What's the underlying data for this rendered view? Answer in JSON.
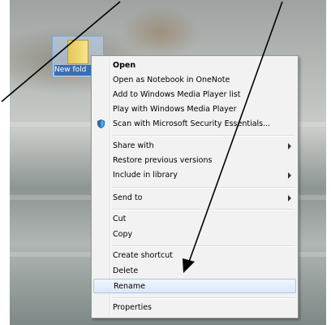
{
  "desktop": {
    "folder": {
      "label": "New fold",
      "icon": "folder-icon"
    }
  },
  "context_menu": {
    "items": [
      {
        "label": "Open",
        "bold": true
      },
      {
        "label": "Open as Notebook in OneNote"
      },
      {
        "label": "Add to Windows Media Player list"
      },
      {
        "label": "Play with Windows Media Player"
      },
      {
        "label": "Scan with Microsoft Security Essentials...",
        "icon": "security-shield-icon"
      },
      {
        "label": "Share with",
        "submenu": true
      },
      {
        "label": "Restore previous versions"
      },
      {
        "label": "Include in library",
        "submenu": true
      },
      {
        "label": "Send to",
        "submenu": true
      },
      {
        "label": "Cut"
      },
      {
        "label": "Copy"
      },
      {
        "label": "Create shortcut"
      },
      {
        "label": "Delete"
      },
      {
        "label": "Rename",
        "highlighted": true
      },
      {
        "label": "Properties"
      }
    ]
  },
  "annotation": {
    "arrow_target": "Rename",
    "color": "#000000"
  },
  "colors": {
    "highlight_border": "#a8c6ec",
    "menu_bg": "#f2f2f2",
    "selection": "#3a6fb0"
  }
}
